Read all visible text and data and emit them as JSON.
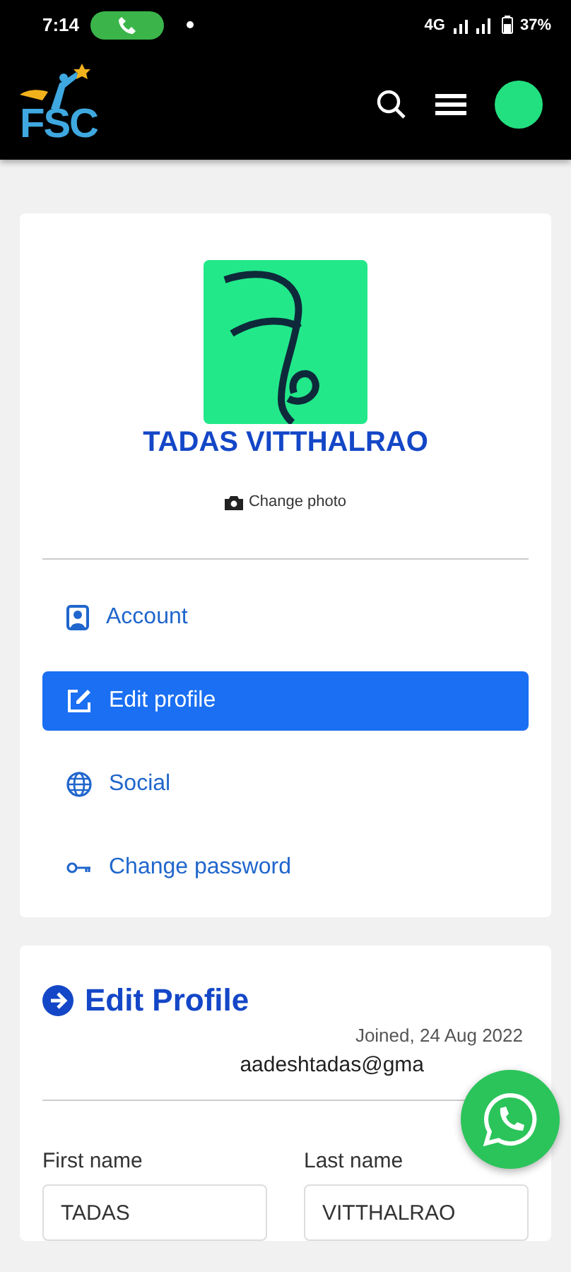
{
  "status_bar": {
    "time": "7:14",
    "network": "4G",
    "battery": "37%"
  },
  "app_bar": {
    "logo": "FSC"
  },
  "profile": {
    "name": "TADAS VITTHALRAO",
    "change_photo": "Change photo"
  },
  "menu": [
    {
      "label": "Account",
      "kind": "account",
      "selected": false
    },
    {
      "label": "Edit profile",
      "kind": "edit",
      "selected": true
    },
    {
      "label": "Social",
      "kind": "globe",
      "selected": false
    },
    {
      "label": "Change password",
      "kind": "key",
      "selected": false
    }
  ],
  "edit_profile": {
    "title": "Edit Profile",
    "joined": "Joined, 24 Aug 2022",
    "email": "aadeshtadas@gma",
    "fields": [
      {
        "label": "First name",
        "value": "TADAS"
      },
      {
        "label": "Last name",
        "value": "VITTHALRAO"
      }
    ]
  }
}
